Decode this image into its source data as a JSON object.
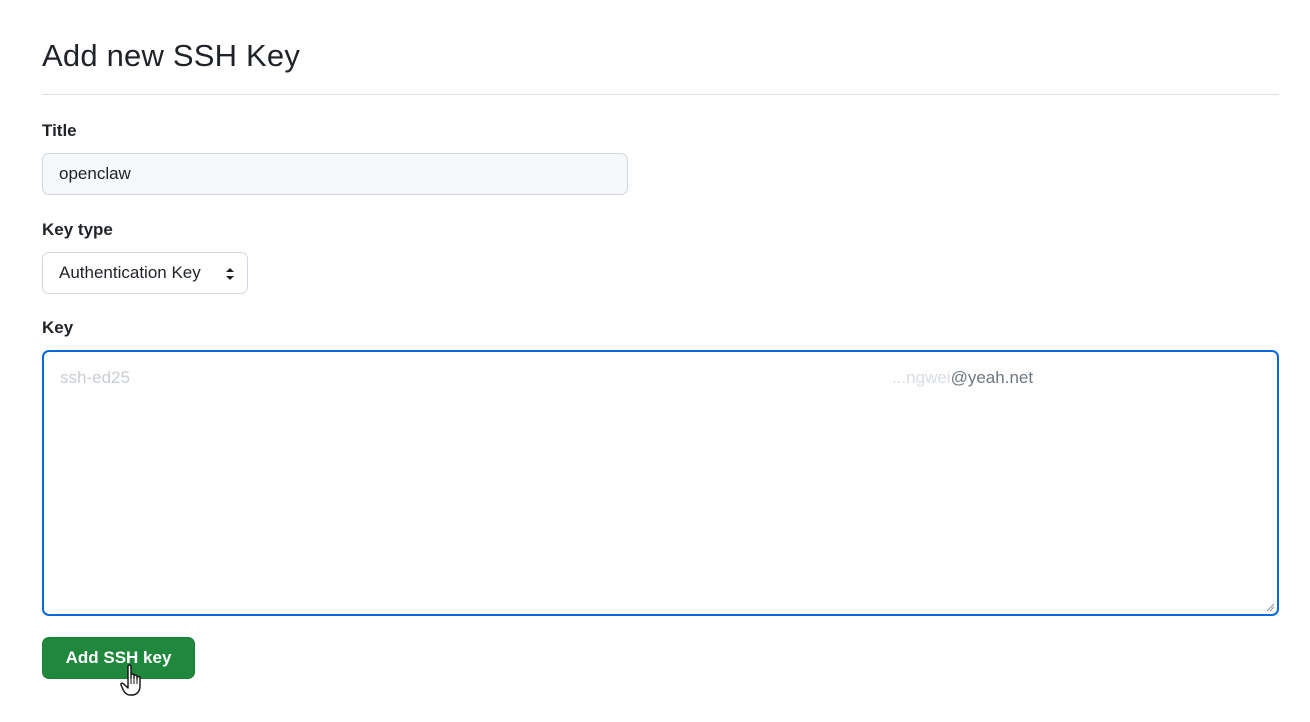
{
  "form": {
    "heading": "Add new SSH Key",
    "title_label": "Title",
    "title_value": "openclaw",
    "key_type_label": "Key type",
    "key_type_selected": "Authentication Key",
    "key_label": "Key",
    "key_value_prefix": "ssh-ed25",
    "key_value_suffix_faded": "...ngwei",
    "key_value_suffix": "@yeah.net",
    "submit_label": "Add SSH key"
  },
  "icons": {
    "select_chevron": "chevron-updown-icon",
    "resize_grip": "resize-grip-icon",
    "cursor": "hand-pointer-icon"
  },
  "colors": {
    "accent": "#0969da",
    "primary_button": "#1f883d",
    "input_bg": "#f6f8fa",
    "border": "#d0d7de"
  }
}
